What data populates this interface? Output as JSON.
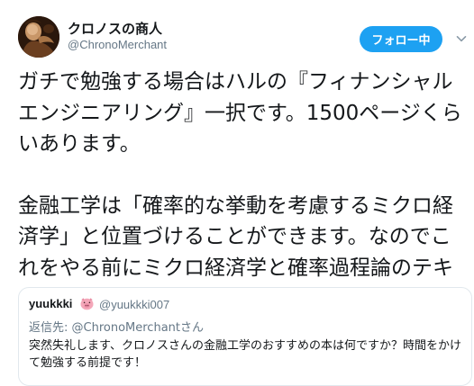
{
  "author": {
    "display_name": "クロノスの商人",
    "handle": "@ChronoMerchant",
    "avatar_icon": "avatar-image"
  },
  "follow_button": {
    "label": "フォロー中",
    "color": "#1da1f2"
  },
  "menu_icon": "chevron-down-icon",
  "tweet": {
    "paragraph_1": "ガチで勉強する場合はハルの『フィナンシャルエンジニアリング』一択です。1500ページくらいあります。",
    "paragraph_2": "金融工学は「確率的な挙動を考慮するミクロ経済学」と位置づけることができます。なのでこれをやる前にミクロ経済学と確率過程論のテキストを一冊ずつ必ずやってください。"
  },
  "quoted_tweet": {
    "display_name": "yuukkki",
    "emoji_icon": "pig-icon",
    "handle": "@yuukkki007",
    "reply_prefix": "返信先: ",
    "reply_mention": "@ChronoMerchant",
    "reply_suffix": "さん",
    "text": "突然失礼します、クロノスさんの金融工学のおすすめの本は何ですか？時間をかけて勉強する前提です！"
  },
  "colors": {
    "text_primary": "#14171a",
    "text_secondary": "#657786",
    "border": "#e1e8ed",
    "accent": "#1da1f2"
  }
}
